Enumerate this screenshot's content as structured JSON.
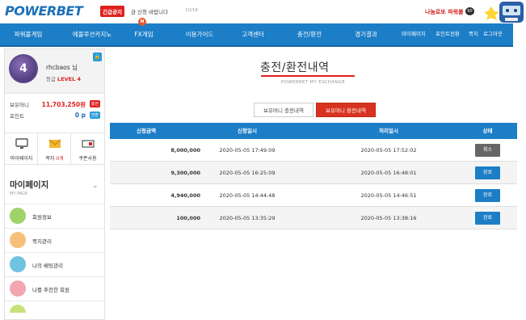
{
  "header": {
    "logo_part1": "POWER",
    "logo_part2": "BET",
    "notice_badge": "긴급공지",
    "notice_text": "금 신청 바랍니다",
    "notice_count": "10/16",
    "nanum_label": "나눔로또 파워볼",
    "nanum_icon": "60"
  },
  "nav": {
    "items": [
      "파워볼게임",
      "에볼루션카지노",
      "FX게임",
      "이용가이드",
      "고객센터",
      "충전/환전",
      "경기결과"
    ],
    "fx_badge": "N",
    "util": [
      "마이페이지",
      "포인트전환",
      "쪽지",
      "로그아웃"
    ]
  },
  "profile": {
    "avatar_level": "4",
    "username": "rhcbaos 님",
    "level_label": "등급",
    "level_value": "LEVEL 4",
    "money_label": "보유머니",
    "money_value": "11,703,250원",
    "money_pill": "충전",
    "point_label": "포인트",
    "point_value": "0 p",
    "point_pill": "전환"
  },
  "quick": {
    "mypage": "마이페이지",
    "message_prefix": "쪽지",
    "message_count": "0개",
    "coupon": "쿠폰사용"
  },
  "mypage": {
    "title": "마이페이지",
    "subtitle": "MY PAGE",
    "menu": [
      "회원정보",
      "쪽지관리",
      "나의 베팅관리",
      "나를 추천한 회원"
    ]
  },
  "main": {
    "title": "충전/환전내역",
    "subtitle": "POWERBET MY EXCHANGE",
    "tab_off": "보유머니 충전내역",
    "tab_on": "보유머니 환전내역"
  },
  "table": {
    "headers": [
      "신청금액",
      "신청일시",
      "처리일시",
      "상태"
    ],
    "rows": [
      {
        "amount": "8,000,000",
        "requested": "2020-05-05 17:49:09",
        "processed": "2020-05-05 17:52:02",
        "status": "취소",
        "status_type": "cancel"
      },
      {
        "amount": "9,300,000",
        "requested": "2020-05-05 16:25:09",
        "processed": "2020-05-05 16:48:01",
        "status": "완료",
        "status_type": "done"
      },
      {
        "amount": "4,940,000",
        "requested": "2020-05-05 14:44:48",
        "processed": "2020-05-05 14:46:51",
        "status": "완료",
        "status_type": "done"
      },
      {
        "amount": "100,000",
        "requested": "2020-05-05 13:35:29",
        "processed": "2020-05-05 13:38:16",
        "status": "완료",
        "status_type": "done"
      }
    ]
  },
  "colors": {
    "brand_blue": "#1c7ec7",
    "accent_red": "#e02020",
    "active_tab": "#d7331f"
  }
}
